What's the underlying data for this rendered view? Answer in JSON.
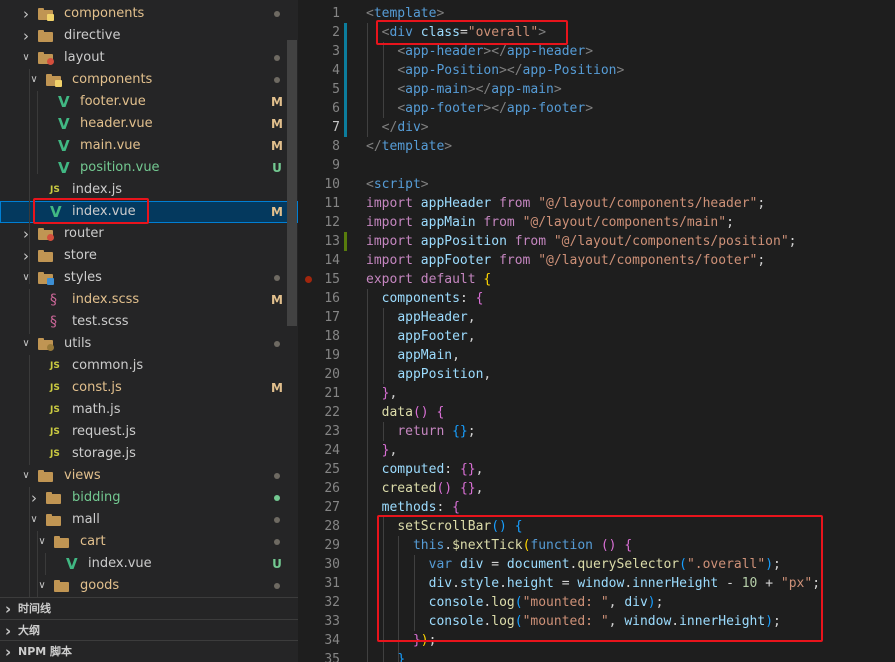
{
  "explorer": {
    "items": [
      {
        "label": "components",
        "type": "folder",
        "expanded": false,
        "badge": "y",
        "color": "ylw",
        "status": "dot-gray"
      },
      {
        "label": "directive",
        "type": "folder",
        "expanded": false,
        "badge": "none",
        "color": "normal",
        "status": ""
      },
      {
        "label": "layout",
        "type": "folder",
        "expanded": true,
        "badge": "r",
        "color": "normal",
        "status": "dot-gray"
      },
      {
        "label": "components",
        "type": "folder",
        "expanded": true,
        "badge": "y",
        "color": "ylw",
        "status": "dot-gray"
      },
      {
        "label": "footer.vue",
        "type": "vue",
        "color": "ylw",
        "status": "M"
      },
      {
        "label": "header.vue",
        "type": "vue",
        "color": "ylw",
        "status": "M"
      },
      {
        "label": "main.vue",
        "type": "vue",
        "color": "ylw",
        "status": "M"
      },
      {
        "label": "position.vue",
        "type": "vue",
        "color": "grn",
        "status": "U"
      },
      {
        "label": "index.js",
        "type": "js",
        "color": "normal",
        "status": ""
      },
      {
        "label": "index.vue",
        "type": "vue",
        "color": "normal",
        "status": "M",
        "selected": true
      },
      {
        "label": "router",
        "type": "folder",
        "expanded": false,
        "badge": "r",
        "color": "normal",
        "status": ""
      },
      {
        "label": "store",
        "type": "folder",
        "expanded": false,
        "badge": "none",
        "color": "normal",
        "status": ""
      },
      {
        "label": "styles",
        "type": "folder",
        "expanded": true,
        "badge": "b",
        "color": "normal",
        "status": "dot-gray"
      },
      {
        "label": "index.scss",
        "type": "sass",
        "color": "ylw",
        "status": "M"
      },
      {
        "label": "test.scss",
        "type": "sass",
        "color": "normal",
        "status": ""
      },
      {
        "label": "utils",
        "type": "folder",
        "expanded": true,
        "badge": "g",
        "color": "normal",
        "status": "dot-gray"
      },
      {
        "label": "common.js",
        "type": "js",
        "color": "normal",
        "status": ""
      },
      {
        "label": "const.js",
        "type": "js",
        "color": "ylw",
        "status": "M"
      },
      {
        "label": "math.js",
        "type": "js",
        "color": "normal",
        "status": ""
      },
      {
        "label": "request.js",
        "type": "js",
        "color": "normal",
        "status": ""
      },
      {
        "label": "storage.js",
        "type": "js",
        "color": "normal",
        "status": ""
      },
      {
        "label": "views",
        "type": "folder",
        "expanded": true,
        "badge": "none",
        "color": "ylw",
        "status": "dot-gray"
      },
      {
        "label": "bidding",
        "type": "folder",
        "expanded": false,
        "badge": "none",
        "color": "grn",
        "status": "dot-green"
      },
      {
        "label": "mall",
        "type": "folder",
        "expanded": true,
        "badge": "none",
        "color": "normal",
        "status": "dot-gray"
      },
      {
        "label": "cart",
        "type": "folder",
        "expanded": true,
        "badge": "none",
        "color": "ylw",
        "status": "dot-gray"
      },
      {
        "label": "index.vue",
        "type": "vue",
        "color": "normal",
        "status": "U"
      },
      {
        "label": "goods",
        "type": "folder",
        "expanded": true,
        "badge": "none",
        "color": "ylw",
        "status": "dot-gray"
      }
    ],
    "sections": [
      {
        "label": "时间线"
      },
      {
        "label": "大纲"
      },
      {
        "label": "NPM 脚本"
      }
    ]
  },
  "editor": {
    "line_numbers": [
      "1",
      "2",
      "3",
      "4",
      "5",
      "6",
      "7",
      "8",
      "9",
      "10",
      "11",
      "12",
      "13",
      "14",
      "15",
      "16",
      "17",
      "18",
      "19",
      "20",
      "21",
      "22",
      "23",
      "24",
      "25",
      "26",
      "27",
      "28",
      "29",
      "30",
      "31",
      "32",
      "33",
      "34",
      "35"
    ],
    "current_line": "7",
    "lines": [
      [
        [
          "t-tag",
          "<"
        ],
        [
          "t-name",
          "template"
        ],
        [
          "t-tag",
          ">"
        ]
      ],
      [
        [
          "t-pl",
          "  "
        ],
        [
          "t-tag",
          "<"
        ],
        [
          "t-name",
          "div"
        ],
        [
          "t-pl",
          " "
        ],
        [
          "t-attr",
          "class"
        ],
        [
          "t-pl",
          "="
        ],
        [
          "t-str",
          "\"overall\""
        ],
        [
          "t-tag",
          ">"
        ]
      ],
      [
        [
          "t-pl",
          "    "
        ],
        [
          "t-tag",
          "<"
        ],
        [
          "t-name",
          "app-header"
        ],
        [
          "t-tag",
          "></"
        ],
        [
          "t-name",
          "app-header"
        ],
        [
          "t-tag",
          ">"
        ]
      ],
      [
        [
          "t-pl",
          "    "
        ],
        [
          "t-tag",
          "<"
        ],
        [
          "t-name",
          "app-Position"
        ],
        [
          "t-tag",
          "></"
        ],
        [
          "t-name",
          "app-Position"
        ],
        [
          "t-tag",
          ">"
        ]
      ],
      [
        [
          "t-pl",
          "    "
        ],
        [
          "t-tag",
          "<"
        ],
        [
          "t-name",
          "app-main"
        ],
        [
          "t-tag",
          "></"
        ],
        [
          "t-name",
          "app-main"
        ],
        [
          "t-tag",
          ">"
        ]
      ],
      [
        [
          "t-pl",
          "    "
        ],
        [
          "t-tag",
          "<"
        ],
        [
          "t-name",
          "app-footer"
        ],
        [
          "t-tag",
          "></"
        ],
        [
          "t-name",
          "app-footer"
        ],
        [
          "t-tag",
          ">"
        ]
      ],
      [
        [
          "t-pl",
          "  "
        ],
        [
          "t-tag",
          "</"
        ],
        [
          "t-name",
          "div"
        ],
        [
          "t-tag",
          ">"
        ]
      ],
      [
        [
          "t-tag",
          "</"
        ],
        [
          "t-name",
          "template"
        ],
        [
          "t-tag",
          ">"
        ]
      ],
      [],
      [
        [
          "t-tag",
          "<"
        ],
        [
          "t-name",
          "script"
        ],
        [
          "t-tag",
          ">"
        ]
      ],
      [
        [
          "t-kw",
          "import"
        ],
        [
          "t-pl",
          " "
        ],
        [
          "t-var",
          "appHeader"
        ],
        [
          "t-pl",
          " "
        ],
        [
          "t-kw",
          "from"
        ],
        [
          "t-pl",
          " "
        ],
        [
          "t-str",
          "\"@/layout/components/header\""
        ],
        [
          "t-pl",
          ";"
        ]
      ],
      [
        [
          "t-kw",
          "import"
        ],
        [
          "t-pl",
          " "
        ],
        [
          "t-var",
          "appMain"
        ],
        [
          "t-pl",
          " "
        ],
        [
          "t-kw",
          "from"
        ],
        [
          "t-pl",
          " "
        ],
        [
          "t-str",
          "\"@/layout/components/main\""
        ],
        [
          "t-pl",
          ";"
        ]
      ],
      [
        [
          "t-kw",
          "import"
        ],
        [
          "t-pl",
          " "
        ],
        [
          "t-var",
          "appPosition"
        ],
        [
          "t-pl",
          " "
        ],
        [
          "t-kw",
          "from"
        ],
        [
          "t-pl",
          " "
        ],
        [
          "t-str",
          "\"@/layout/components/position\""
        ],
        [
          "t-pl",
          ";"
        ]
      ],
      [
        [
          "t-kw",
          "import"
        ],
        [
          "t-pl",
          " "
        ],
        [
          "t-var",
          "appFooter"
        ],
        [
          "t-pl",
          " "
        ],
        [
          "t-kw",
          "from"
        ],
        [
          "t-pl",
          " "
        ],
        [
          "t-str",
          "\"@/layout/components/footer\""
        ],
        [
          "t-pl",
          ";"
        ]
      ],
      [
        [
          "t-kw",
          "export"
        ],
        [
          "t-pl",
          " "
        ],
        [
          "t-kw",
          "default"
        ],
        [
          "t-pl",
          " "
        ],
        [
          "t-br1",
          "{"
        ]
      ],
      [
        [
          "t-pl",
          "  "
        ],
        [
          "t-var",
          "components"
        ],
        [
          "t-pl",
          ": "
        ],
        [
          "t-br2",
          "{"
        ]
      ],
      [
        [
          "t-pl",
          "    "
        ],
        [
          "t-var",
          "appHeader"
        ],
        [
          "t-pl",
          ","
        ]
      ],
      [
        [
          "t-pl",
          "    "
        ],
        [
          "t-var",
          "appFooter"
        ],
        [
          "t-pl",
          ","
        ]
      ],
      [
        [
          "t-pl",
          "    "
        ],
        [
          "t-var",
          "appMain"
        ],
        [
          "t-pl",
          ","
        ]
      ],
      [
        [
          "t-pl",
          "    "
        ],
        [
          "t-var",
          "appPosition"
        ],
        [
          "t-pl",
          ","
        ]
      ],
      [
        [
          "t-pl",
          "  "
        ],
        [
          "t-br2",
          "}"
        ],
        [
          "t-pl",
          ","
        ]
      ],
      [
        [
          "t-pl",
          "  "
        ],
        [
          "t-fn",
          "data"
        ],
        [
          "t-br2",
          "()"
        ],
        [
          "t-pl",
          " "
        ],
        [
          "t-br2",
          "{"
        ]
      ],
      [
        [
          "t-pl",
          "    "
        ],
        [
          "t-kw",
          "return"
        ],
        [
          "t-pl",
          " "
        ],
        [
          "t-br3",
          "{}"
        ],
        [
          "t-pl",
          ";"
        ]
      ],
      [
        [
          "t-pl",
          "  "
        ],
        [
          "t-br2",
          "}"
        ],
        [
          "t-pl",
          ","
        ]
      ],
      [
        [
          "t-pl",
          "  "
        ],
        [
          "t-var",
          "computed"
        ],
        [
          "t-pl",
          ": "
        ],
        [
          "t-br2",
          "{}"
        ],
        [
          "t-pl",
          ","
        ]
      ],
      [
        [
          "t-pl",
          "  "
        ],
        [
          "t-fn",
          "created"
        ],
        [
          "t-br2",
          "()"
        ],
        [
          "t-pl",
          " "
        ],
        [
          "t-br2",
          "{}"
        ],
        [
          "t-pl",
          ","
        ]
      ],
      [
        [
          "t-pl",
          "  "
        ],
        [
          "t-var",
          "methods"
        ],
        [
          "t-pl",
          ": "
        ],
        [
          "t-br2",
          "{"
        ]
      ],
      [
        [
          "t-pl",
          "    "
        ],
        [
          "t-fn",
          "setScrollBar"
        ],
        [
          "t-br3",
          "()"
        ],
        [
          "t-pl",
          " "
        ],
        [
          "t-br3",
          "{"
        ]
      ],
      [
        [
          "t-pl",
          "      "
        ],
        [
          "t-blue",
          "this"
        ],
        [
          "t-pl",
          "."
        ],
        [
          "t-fn",
          "$nextTick"
        ],
        [
          "t-br1",
          "("
        ],
        [
          "t-blue",
          "function"
        ],
        [
          "t-pl",
          " "
        ],
        [
          "t-br2",
          "()"
        ],
        [
          "t-pl",
          " "
        ],
        [
          "t-br2",
          "{"
        ]
      ],
      [
        [
          "t-pl",
          "        "
        ],
        [
          "t-blue",
          "var"
        ],
        [
          "t-pl",
          " "
        ],
        [
          "t-var",
          "div"
        ],
        [
          "t-pl",
          " = "
        ],
        [
          "t-var",
          "document"
        ],
        [
          "t-pl",
          "."
        ],
        [
          "t-fn",
          "querySelector"
        ],
        [
          "t-br3",
          "("
        ],
        [
          "t-str",
          "\".overall\""
        ],
        [
          "t-br3",
          ")"
        ],
        [
          "t-pl",
          ";"
        ]
      ],
      [
        [
          "t-pl",
          "        "
        ],
        [
          "t-var",
          "div"
        ],
        [
          "t-pl",
          "."
        ],
        [
          "t-var",
          "style"
        ],
        [
          "t-pl",
          "."
        ],
        [
          "t-var",
          "height"
        ],
        [
          "t-pl",
          " = "
        ],
        [
          "t-var",
          "window"
        ],
        [
          "t-pl",
          "."
        ],
        [
          "t-var",
          "innerHeight"
        ],
        [
          "t-pl",
          " - "
        ],
        [
          "t-num",
          "10"
        ],
        [
          "t-pl",
          " + "
        ],
        [
          "t-str",
          "\"px\""
        ],
        [
          "t-pl",
          ";"
        ]
      ],
      [
        [
          "t-pl",
          "        "
        ],
        [
          "t-var",
          "console"
        ],
        [
          "t-pl",
          "."
        ],
        [
          "t-fn",
          "log"
        ],
        [
          "t-br3",
          "("
        ],
        [
          "t-str",
          "\"mounted: \""
        ],
        [
          "t-pl",
          ", "
        ],
        [
          "t-var",
          "div"
        ],
        [
          "t-br3",
          ")"
        ],
        [
          "t-pl",
          ";"
        ]
      ],
      [
        [
          "t-pl",
          "        "
        ],
        [
          "t-var",
          "console"
        ],
        [
          "t-pl",
          "."
        ],
        [
          "t-fn",
          "log"
        ],
        [
          "t-br3",
          "("
        ],
        [
          "t-str",
          "\"mounted: \""
        ],
        [
          "t-pl",
          ", "
        ],
        [
          "t-var",
          "window"
        ],
        [
          "t-pl",
          "."
        ],
        [
          "t-var",
          "innerHeight"
        ],
        [
          "t-br3",
          ")"
        ],
        [
          "t-pl",
          ";"
        ]
      ],
      [
        [
          "t-pl",
          "      "
        ],
        [
          "t-br2",
          "}"
        ],
        [
          "t-br1",
          ")"
        ],
        [
          "t-pl",
          ";"
        ]
      ],
      [
        [
          "t-pl",
          "    "
        ],
        [
          "t-br3",
          "}"
        ]
      ]
    ]
  }
}
